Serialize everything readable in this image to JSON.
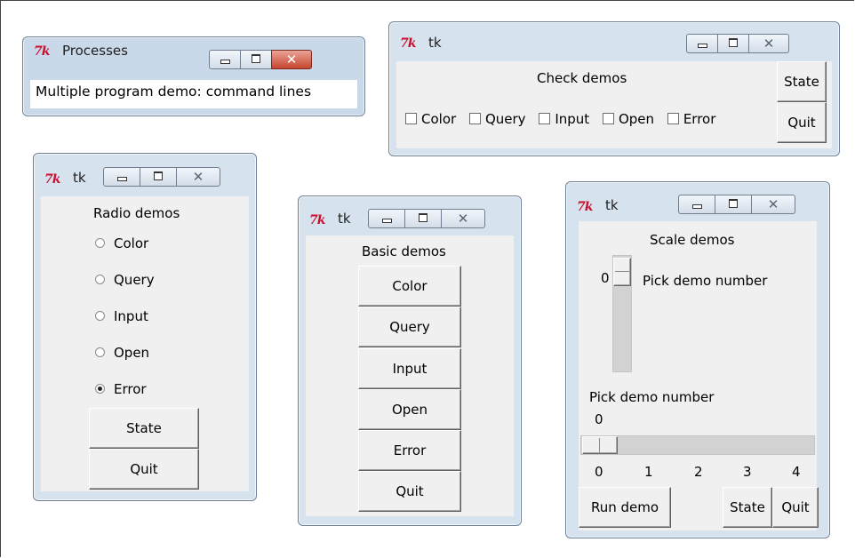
{
  "processes_window": {
    "title": "Processes",
    "body_text": "Multiple program demo: command lines"
  },
  "check_window": {
    "title": "tk",
    "heading": "Check demos",
    "checkboxes": [
      {
        "label": "Color",
        "checked": false
      },
      {
        "label": "Query",
        "checked": false
      },
      {
        "label": "Input",
        "checked": false
      },
      {
        "label": "Open",
        "checked": false
      },
      {
        "label": "Error",
        "checked": false
      }
    ],
    "state_button": "State",
    "quit_button": "Quit"
  },
  "radio_window": {
    "title": "tk",
    "heading": "Radio demos",
    "radios": [
      {
        "label": "Color",
        "selected": false
      },
      {
        "label": "Query",
        "selected": false
      },
      {
        "label": "Input",
        "selected": false
      },
      {
        "label": "Open",
        "selected": false
      },
      {
        "label": "Error",
        "selected": true
      }
    ],
    "state_button": "State",
    "quit_button": "Quit"
  },
  "basic_window": {
    "title": "tk",
    "heading": "Basic demos",
    "buttons": [
      "Color",
      "Query",
      "Input",
      "Open",
      "Error",
      "Quit"
    ]
  },
  "scale_window": {
    "title": "tk",
    "heading": "Scale demos",
    "vertical_scale": {
      "value": "0",
      "label": "Pick demo number"
    },
    "horizontal_scale": {
      "label": "Pick demo number",
      "value": "0",
      "ticks": [
        "0",
        "1",
        "2",
        "3",
        "4"
      ]
    },
    "run_button": "Run demo",
    "state_button": "State",
    "quit_button": "Quit"
  },
  "window_controls": {
    "minimize": "minimize-icon",
    "maximize": "maximize-icon",
    "close": "close-icon",
    "close_glyph": "✕"
  },
  "colors": {
    "tk_logo": "#c8102e",
    "frame": "#d7e2ef",
    "client": "#f0f0f0",
    "close_active": "#c8452f"
  }
}
